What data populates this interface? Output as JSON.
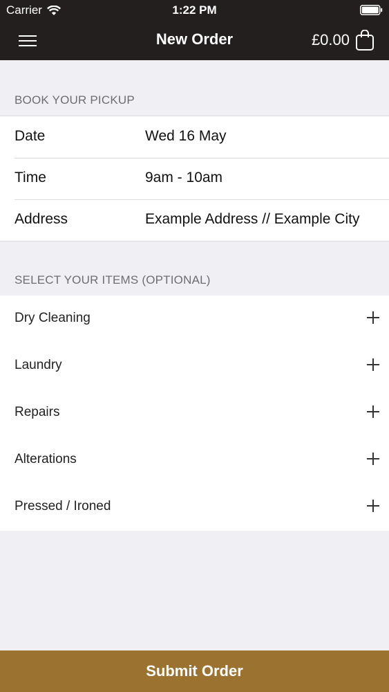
{
  "status_bar": {
    "carrier": "Carrier",
    "time": "1:22 PM"
  },
  "nav": {
    "title": "New Order",
    "cart_total": "£0.00"
  },
  "pickup": {
    "header": "BOOK YOUR PICKUP",
    "rows": [
      {
        "label": "Date",
        "value": "Wed 16 May"
      },
      {
        "label": "Time",
        "value": "9am - 10am"
      },
      {
        "label": "Address",
        "value": "Example Address // Example City"
      }
    ]
  },
  "items": {
    "header": "SELECT YOUR ITEMS (OPTIONAL)",
    "list": [
      {
        "label": "Dry Cleaning"
      },
      {
        "label": "Laundry"
      },
      {
        "label": "Repairs"
      },
      {
        "label": "Alterations"
      },
      {
        "label": "Pressed / Ironed"
      }
    ]
  },
  "footer": {
    "submit_label": "Submit Order"
  },
  "colors": {
    "nav_background": "#231f1f",
    "page_background": "#efeff4",
    "accent": "#9c7231"
  },
  "icons": [
    "wifi-icon",
    "battery-icon",
    "hamburger-menu-icon",
    "shopping-bag-icon",
    "plus-icon"
  ]
}
